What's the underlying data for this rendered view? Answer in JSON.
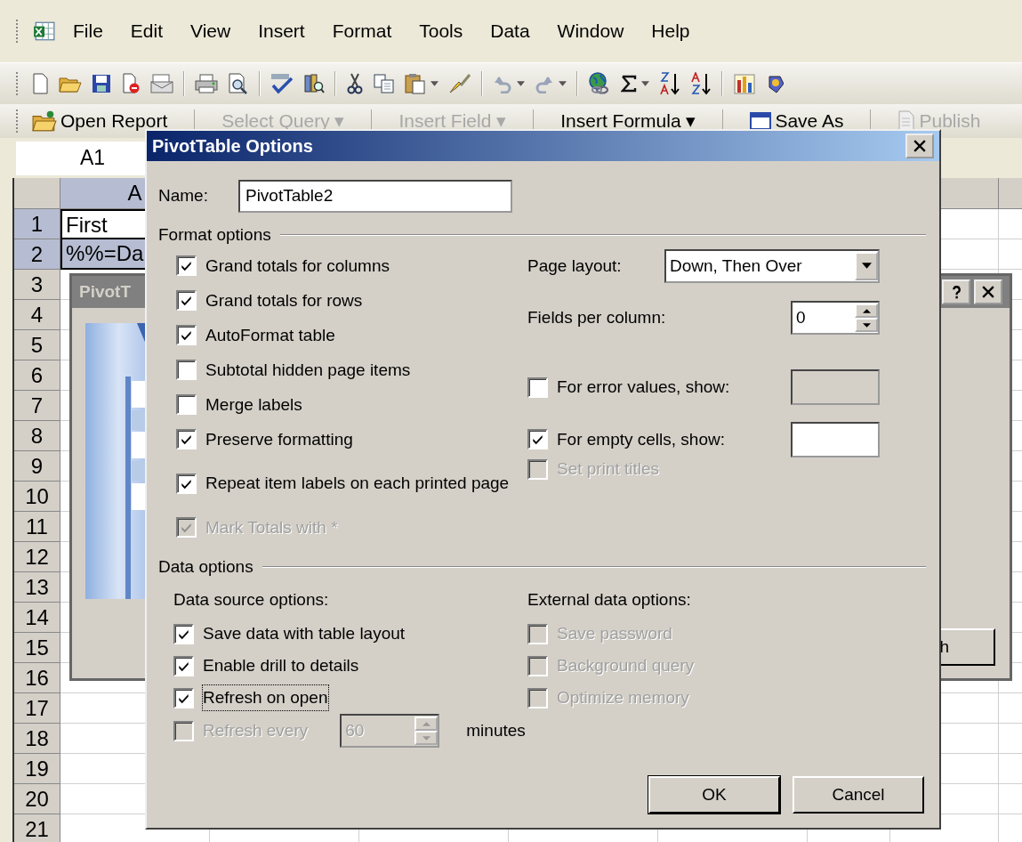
{
  "menu_bar": [
    "File",
    "Edit",
    "View",
    "Insert",
    "Format",
    "Tools",
    "Data",
    "Window",
    "Help"
  ],
  "report_toolbar": [
    {
      "label": "Open Report",
      "disabled": false
    },
    {
      "label": "Select Query ▾",
      "disabled": true
    },
    {
      "label": "Insert Field ▾",
      "disabled": true
    },
    {
      "label": "Insert Formula ▾",
      "disabled": false
    },
    {
      "label": "Save As",
      "disabled": false
    },
    {
      "label": "Publish",
      "disabled": true
    }
  ],
  "name_box": "A1",
  "sheet": {
    "columns": [
      {
        "label": "A",
        "selected": true
      }
    ],
    "rows": [
      {
        "label": "1",
        "selected": true
      },
      {
        "label": "2",
        "selected": true
      },
      {
        "label": "3",
        "selected": false
      },
      {
        "label": "4",
        "selected": false
      },
      {
        "label": "5",
        "selected": false
      },
      {
        "label": "6",
        "selected": false
      },
      {
        "label": "7",
        "selected": false
      },
      {
        "label": "8",
        "selected": false
      },
      {
        "label": "9",
        "selected": false
      },
      {
        "label": "10",
        "selected": false
      },
      {
        "label": "11",
        "selected": false
      },
      {
        "label": "12",
        "selected": false
      },
      {
        "label": "13",
        "selected": false
      },
      {
        "label": "14",
        "selected": false
      },
      {
        "label": "15",
        "selected": false
      },
      {
        "label": "16",
        "selected": false
      },
      {
        "label": "17",
        "selected": false
      },
      {
        "label": "18",
        "selected": false
      },
      {
        "label": "19",
        "selected": false
      },
      {
        "label": "20",
        "selected": false
      },
      {
        "label": "21",
        "selected": false
      }
    ],
    "cells": [
      {
        "text": "First",
        "active": true
      },
      {
        "text": "%%=Da",
        "active": false
      }
    ]
  },
  "wizard": {
    "title": "PivotT",
    "button": "h"
  },
  "dialog": {
    "title": "PivotTable Options",
    "name_label": "Name:",
    "name_value": "PivotTable2",
    "format_heading": "Format options",
    "format_checks": [
      {
        "label": "Grand totals for columns",
        "checked": true,
        "disabled": false
      },
      {
        "label": "Grand totals for rows",
        "checked": true,
        "disabled": false
      },
      {
        "label": "AutoFormat table",
        "checked": true,
        "disabled": false
      },
      {
        "label": "Subtotal hidden page items",
        "checked": false,
        "disabled": false
      },
      {
        "label": "Merge labels",
        "checked": false,
        "disabled": false
      },
      {
        "label": "Preserve formatting",
        "checked": true,
        "disabled": false
      },
      {
        "label": "Repeat item labels on each printed page",
        "checked": true,
        "disabled": false
      },
      {
        "label": "Mark Totals with *",
        "checked": true,
        "disabled": true
      }
    ],
    "page_layout": {
      "label": "Page layout:",
      "value": "Down, Then Over"
    },
    "fields_per_column": {
      "label": "Fields per column:",
      "value": "0"
    },
    "error_values": {
      "label": "For error values, show:",
      "checked": false
    },
    "empty_cells": {
      "label": "For empty cells, show:",
      "checked": true
    },
    "print_titles": {
      "label": "Set print titles",
      "checked": false,
      "disabled": true
    },
    "data_heading": "Data options",
    "source_heading": "Data source options:",
    "source_checks": [
      {
        "label": "Save data with table layout",
        "checked": true,
        "focused": false
      },
      {
        "label": "Enable drill to details",
        "checked": true,
        "focused": false
      },
      {
        "label": "Refresh on open",
        "checked": true,
        "focused": true
      }
    ],
    "refresh_every": {
      "label": "Refresh every",
      "checked": false,
      "disabled": true,
      "value": "60",
      "unit": "minutes"
    },
    "external_heading": "External data options:",
    "external_checks": [
      {
        "label": "Save password",
        "checked": false,
        "disabled": true
      },
      {
        "label": "Background query",
        "checked": false,
        "disabled": true
      },
      {
        "label": "Optimize memory",
        "checked": false,
        "disabled": true
      }
    ],
    "buttons": [
      {
        "label": "OK",
        "default": true
      },
      {
        "label": "Cancel",
        "default": false
      }
    ]
  }
}
